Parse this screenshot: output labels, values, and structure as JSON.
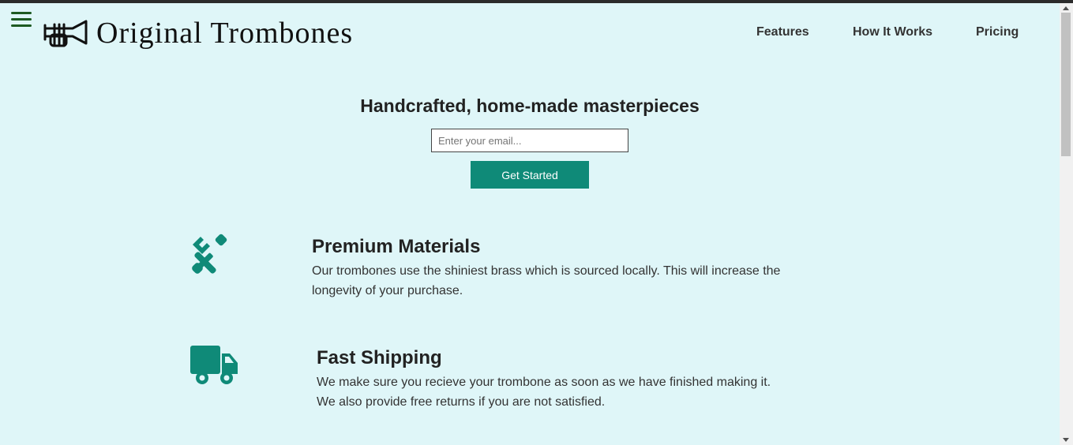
{
  "header": {
    "brand": "Original Trombones",
    "menu_icon": "hamburger-menu-icon",
    "logo_icon": "trumpet-logo-icon",
    "nav": [
      "Features",
      "How It Works",
      "Pricing"
    ]
  },
  "hero": {
    "headline": "Handcrafted, home-made masterpieces",
    "email_placeholder": "Enter your email...",
    "cta_label": "Get Started"
  },
  "features": [
    {
      "icon": "tools-icon",
      "title": "Premium Materials",
      "description": "Our trombones use the shiniest brass which is sourced locally. This will increase the longevity of your purchase."
    },
    {
      "icon": "truck-icon",
      "title": "Fast Shipping",
      "description": "We make sure you recieve your trombone as soon as we have finished making it. We also provide free returns if you are not satisfied."
    }
  ],
  "colors": {
    "background": "#dff6f8",
    "accent": "#0f8a78",
    "menu": "#1d5a22"
  }
}
